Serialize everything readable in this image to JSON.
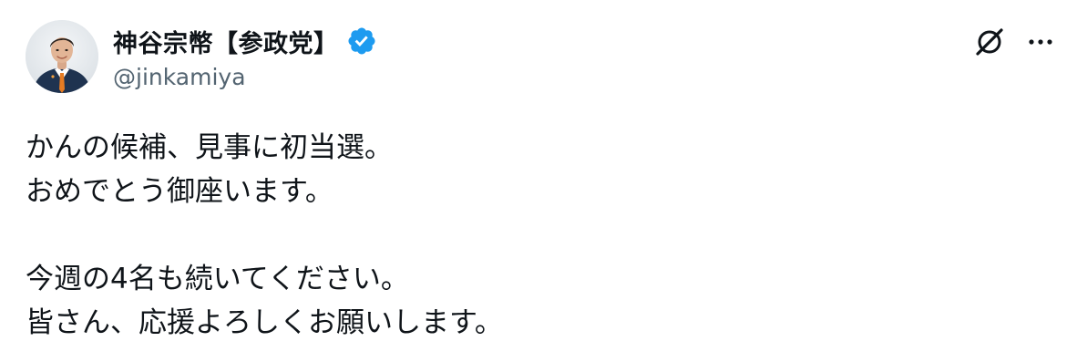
{
  "author": {
    "display_name": "神谷宗幣【参政党】",
    "handle": "@jinkamiya",
    "verified": true,
    "verified_color": "#1d9bf0",
    "avatar_icon": "profile-photo"
  },
  "actions": {
    "grok_icon": "grok-icon",
    "more_icon": "more-icon"
  },
  "tweet": {
    "lines": [
      "かんの候補、見事に初当選。",
      "おめでとう御座います。",
      "",
      "今週の4名も続いてください。",
      "皆さん、応援よろしくお願いします。"
    ]
  }
}
